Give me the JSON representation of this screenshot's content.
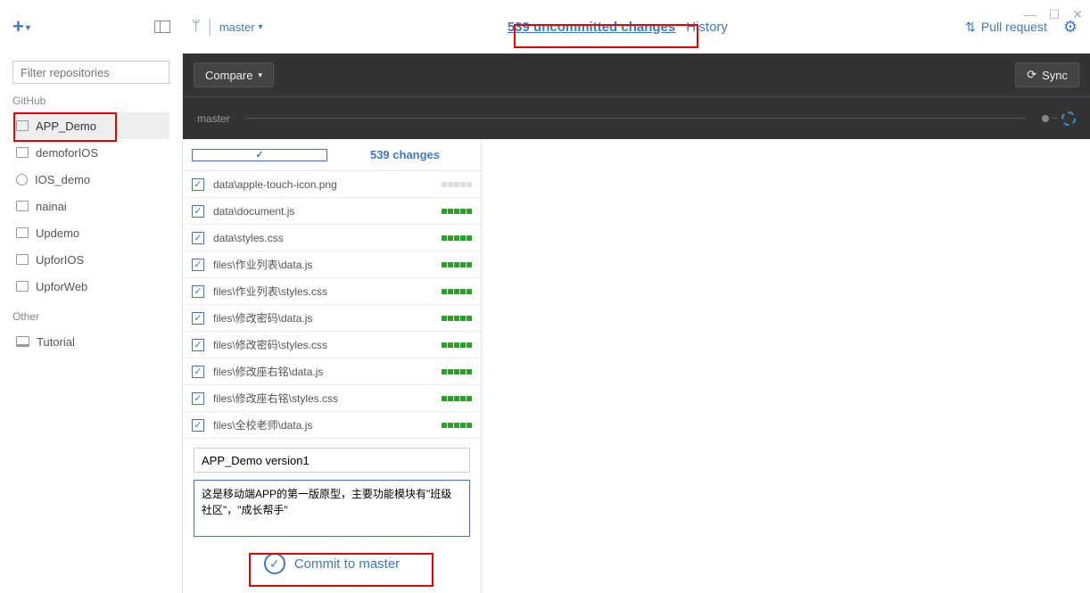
{
  "window": {
    "minimize": "—",
    "maximize": "☐",
    "close": "✕"
  },
  "toolbar": {
    "branch": "master",
    "changes_tab": "539 uncommitted changes",
    "history_tab": "History",
    "pull_request": "Pull request"
  },
  "sidebar": {
    "filter_placeholder": "Filter repositories",
    "section1": "GitHub",
    "section2": "Other",
    "repos": [
      {
        "name": "APP_Demo",
        "active": true,
        "icon": "repo"
      },
      {
        "name": "demoforIOS",
        "active": false,
        "icon": "repo"
      },
      {
        "name": "IOS_demo",
        "active": false,
        "icon": "clock"
      },
      {
        "name": "nainai",
        "active": false,
        "icon": "repo"
      },
      {
        "name": "Updemo",
        "active": false,
        "icon": "repo"
      },
      {
        "name": "UpforIOS",
        "active": false,
        "icon": "repo"
      },
      {
        "name": "UpforWeb",
        "active": false,
        "icon": "repo"
      }
    ],
    "other": [
      {
        "name": "Tutorial",
        "icon": "monitor"
      }
    ]
  },
  "compare": {
    "label": "Compare",
    "sync": "Sync",
    "branch_label": "master"
  },
  "changes": {
    "header": "539 changes",
    "files": [
      {
        "path": "data\\apple-touch-icon.png",
        "mode": "neut"
      },
      {
        "path": "data\\document.js",
        "mode": "add"
      },
      {
        "path": "data\\styles.css",
        "mode": "add"
      },
      {
        "path": "files\\作业列表\\data.js",
        "mode": "add"
      },
      {
        "path": "files\\作业列表\\styles.css",
        "mode": "add"
      },
      {
        "path": "files\\修改密码\\data.js",
        "mode": "add"
      },
      {
        "path": "files\\修改密码\\styles.css",
        "mode": "add"
      },
      {
        "path": "files\\修改座右铭\\data.js",
        "mode": "add"
      },
      {
        "path": "files\\修改座右铭\\styles.css",
        "mode": "add"
      },
      {
        "path": "files\\全校老师\\data.js",
        "mode": "add"
      }
    ]
  },
  "commit": {
    "summary": "APP_Demo version1",
    "description": "这是移动端APP的第一版原型，主要功能模块有\"班级社区\"，\"成长帮手\"",
    "button": "Commit to master"
  }
}
